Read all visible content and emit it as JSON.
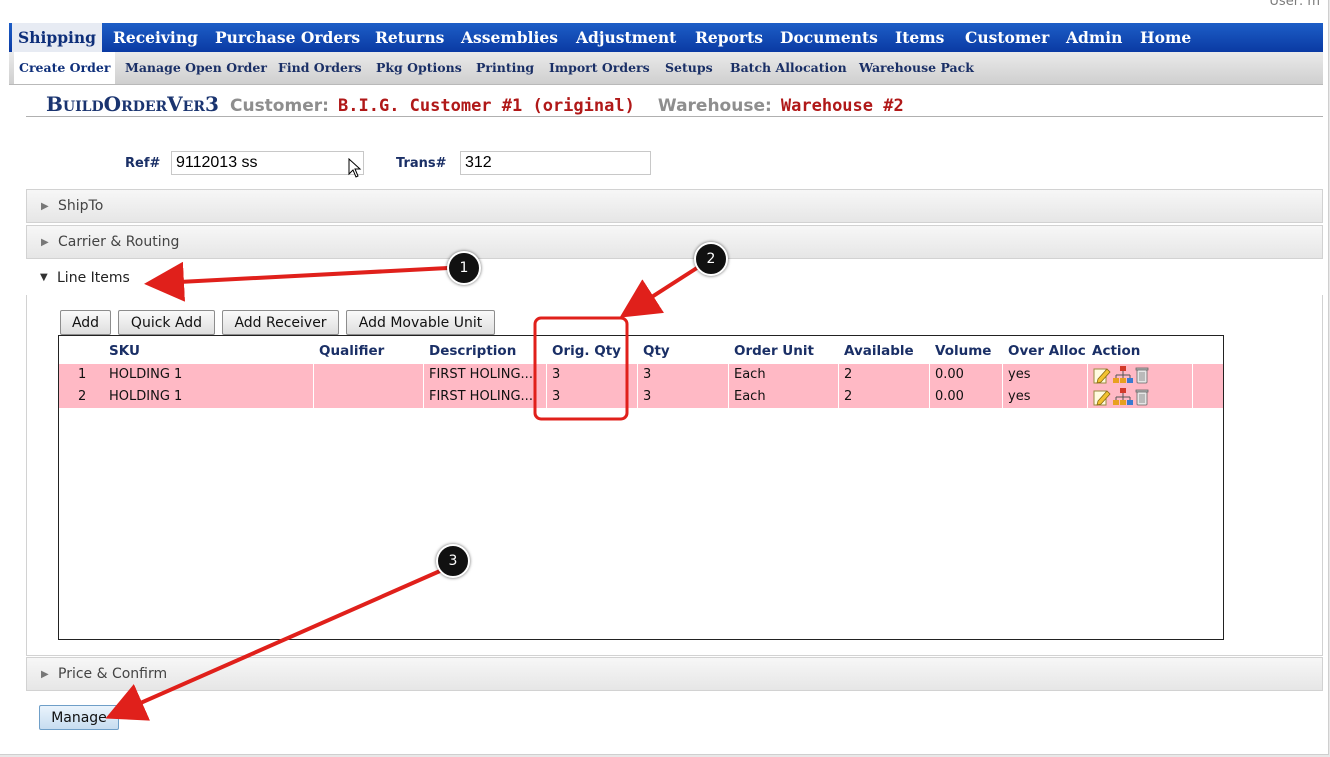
{
  "user_label": "User: m",
  "main_nav": [
    {
      "label": "Shipping",
      "active": true
    },
    {
      "label": "Receiving"
    },
    {
      "label": "Purchase Orders"
    },
    {
      "label": "Returns"
    },
    {
      "label": "Assemblies"
    },
    {
      "label": "Adjustment"
    },
    {
      "label": "Reports"
    },
    {
      "label": "Documents"
    },
    {
      "label": "Items"
    },
    {
      "label": "Customer"
    },
    {
      "label": "Admin"
    },
    {
      "label": "Home"
    }
  ],
  "sub_nav": [
    {
      "label": "Create Order",
      "active": true
    },
    {
      "label": "Manage Open Order"
    },
    {
      "label": "Find Orders"
    },
    {
      "label": "Pkg Options"
    },
    {
      "label": "Printing"
    },
    {
      "label": "Import Orders"
    },
    {
      "label": "Setups"
    },
    {
      "label": "Batch Allocation"
    },
    {
      "label": "Warehouse Pack"
    }
  ],
  "header": {
    "title": "BuildOrderVer3",
    "customer_label": "Customer:",
    "customer_value": "B.I.G. Customer #1 (original)",
    "warehouse_label": "Warehouse:",
    "warehouse_value": "Warehouse #2"
  },
  "ref": {
    "label": "Ref#",
    "value": "9112013 ss"
  },
  "trans": {
    "label": "Trans#",
    "value": "312"
  },
  "sections": {
    "shipto": "ShipTo",
    "carrier": "Carrier & Routing",
    "line_items": "Line Items",
    "price": "Price & Confirm"
  },
  "toolbar": {
    "add": "Add",
    "quick_add": "Quick Add",
    "add_receiver": "Add Receiver",
    "add_movable_unit": "Add Movable Unit"
  },
  "grid": {
    "columns": [
      "SKU",
      "Qualifier",
      "Description",
      "Orig. Qty",
      "Qty",
      "Order Unit",
      "Available",
      "Volume",
      "Over Alloc",
      "Action"
    ],
    "rows": [
      {
        "num": "1",
        "sku": "HOLDING 1",
        "qualifier": "",
        "description": "FIRST HOLING...",
        "orig_qty": "3",
        "qty": "3",
        "order_unit": "Each",
        "available": "2",
        "volume": "0.00",
        "over_alloc": "yes"
      },
      {
        "num": "2",
        "sku": "HOLDING 1",
        "qualifier": "",
        "description": "FIRST HOLING...",
        "orig_qty": "3",
        "qty": "3",
        "order_unit": "Each",
        "available": "2",
        "volume": "0.00",
        "over_alloc": "yes"
      }
    ]
  },
  "manage_button": "Manage",
  "annotations": {
    "badge1": "1",
    "badge2": "2",
    "badge3": "3"
  },
  "colors": {
    "nav_blue": "#1d5ec7",
    "row_pink": "#ffb9c5",
    "header_red": "#b01818",
    "annotation_red": "#e0201b"
  }
}
